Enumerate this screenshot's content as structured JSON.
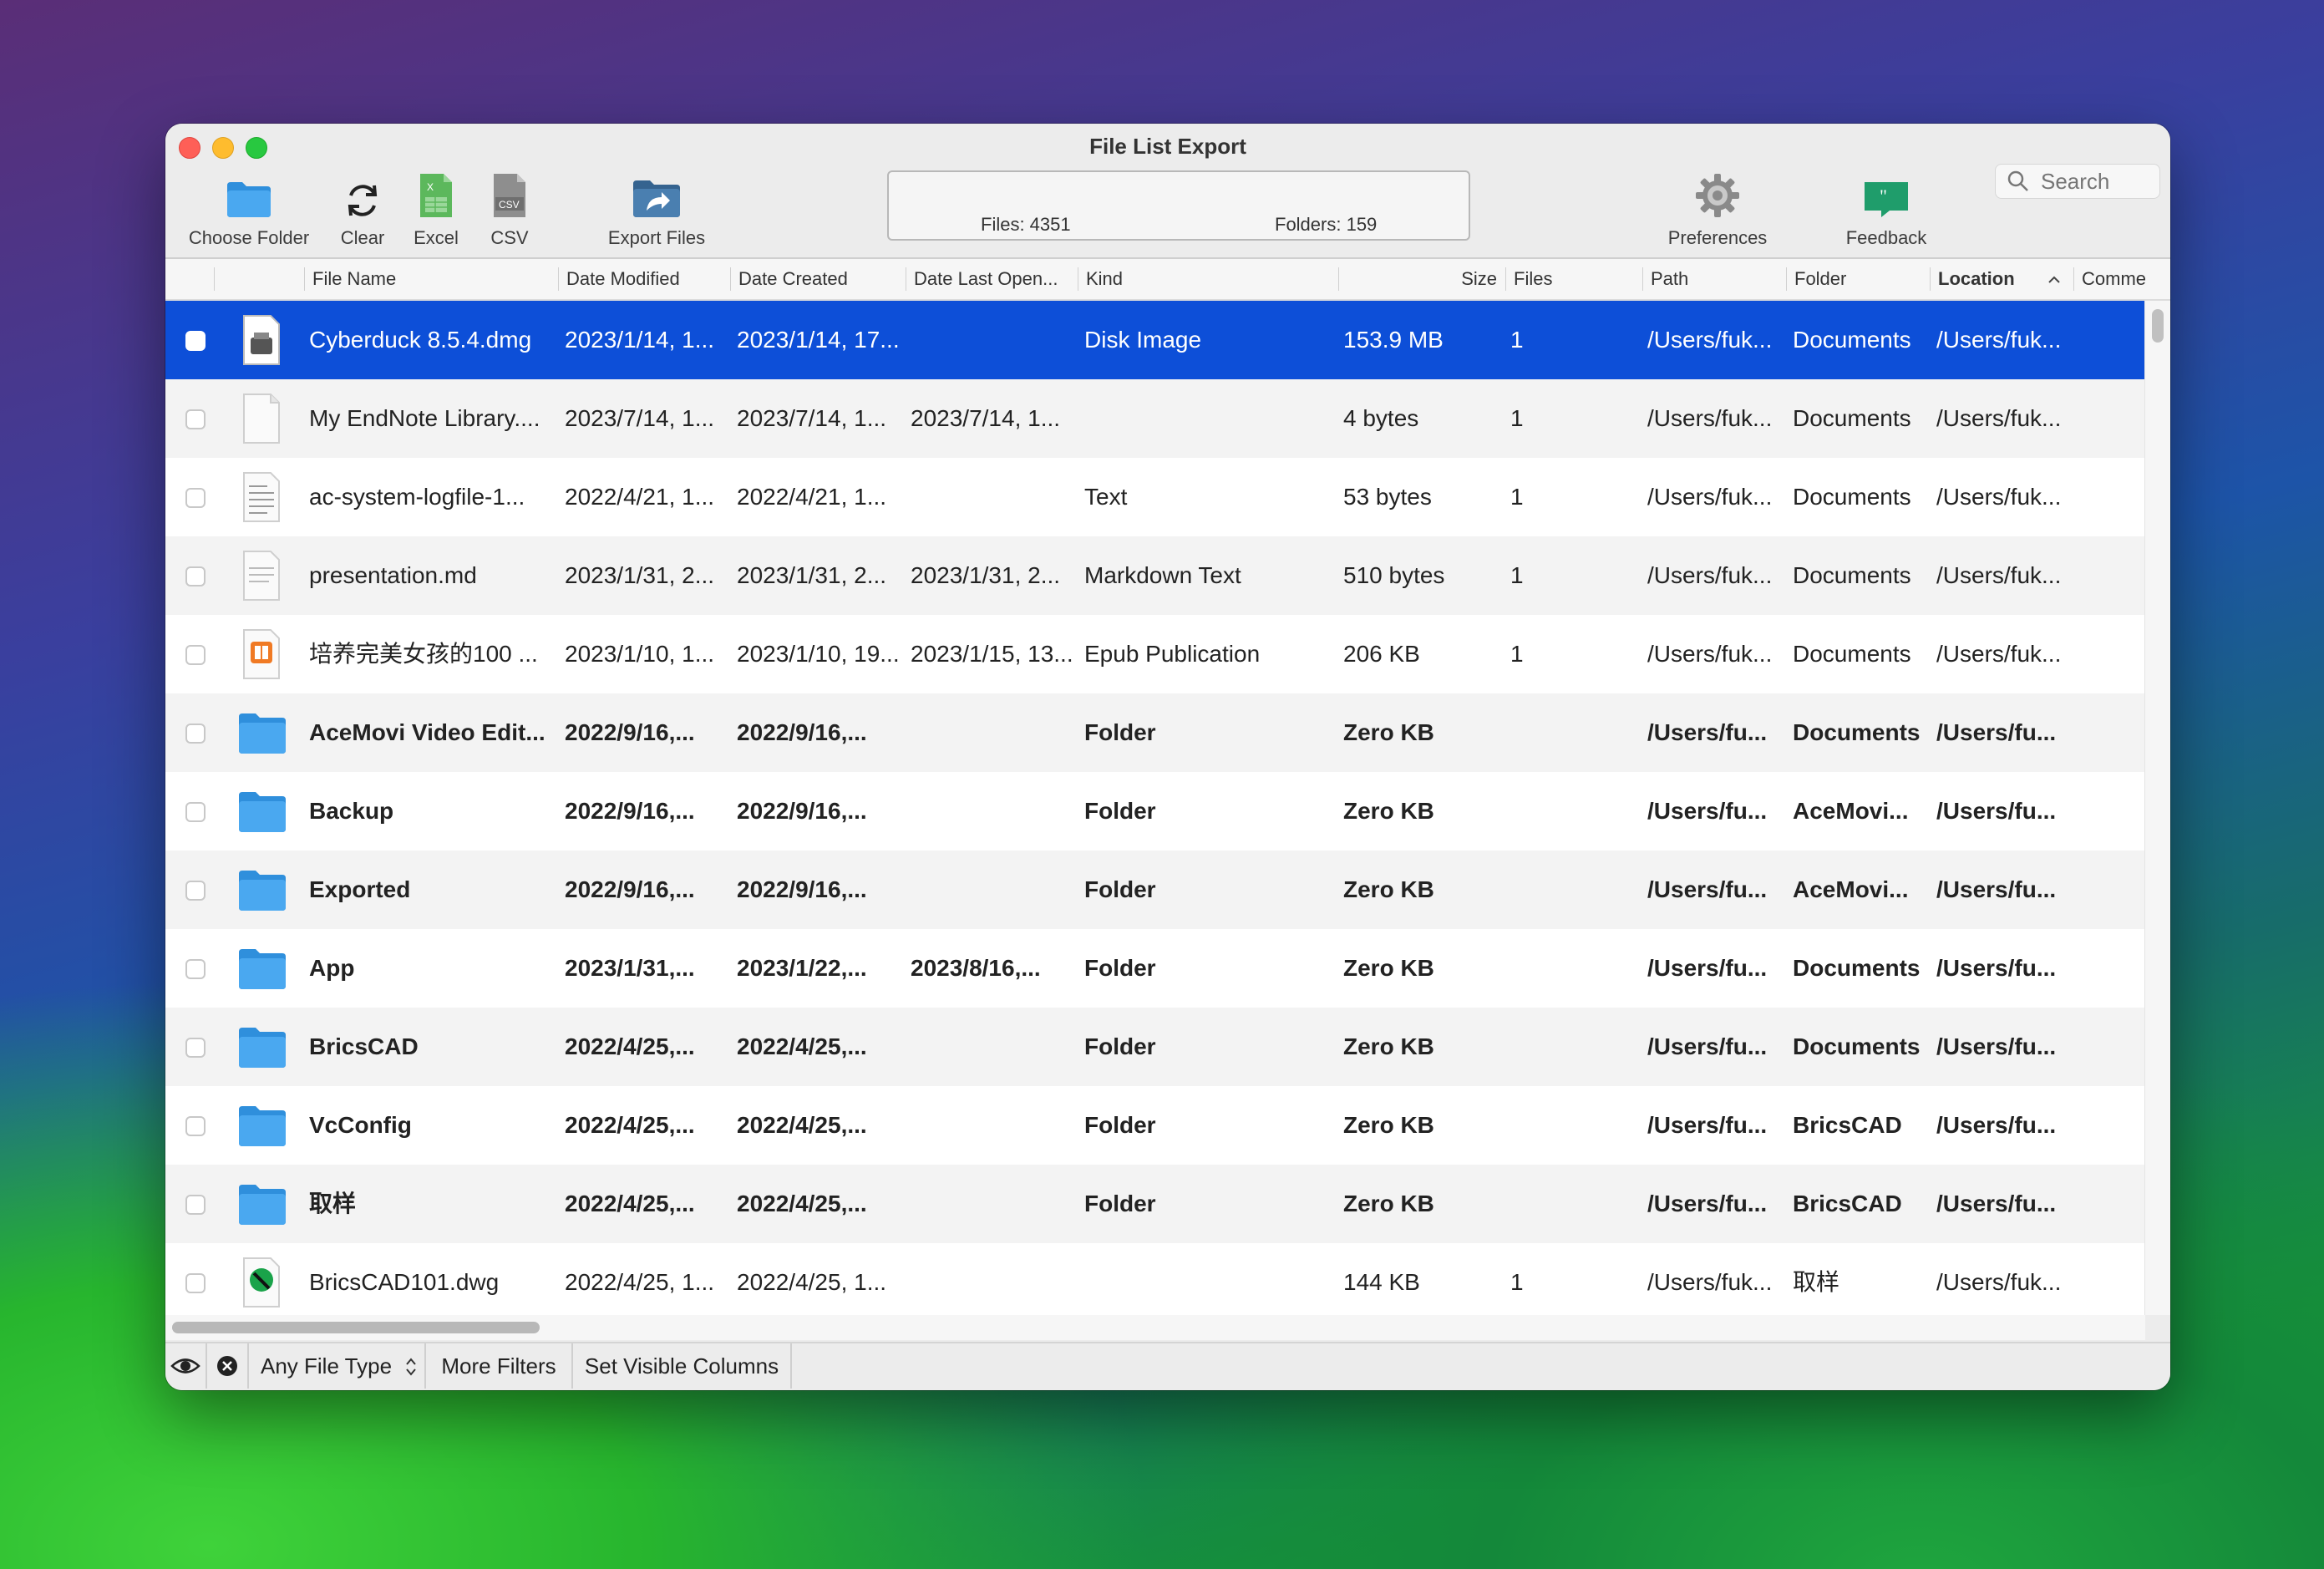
{
  "window": {
    "title": "File List Export"
  },
  "toolbar": {
    "choose_folder": "Choose Folder",
    "clear": "Clear",
    "excel": "Excel",
    "csv": "CSV",
    "export_files": "Export Files",
    "preferences": "Preferences",
    "feedback": "Feedback"
  },
  "stats": {
    "files": "Files: 4351",
    "folders": "Folders: 159"
  },
  "search": {
    "placeholder": "Search"
  },
  "columns": {
    "file_name": "File Name",
    "date_modified": "Date Modified",
    "date_created": "Date Created",
    "date_last_opened": "Date Last Open...",
    "kind": "Kind",
    "size": "Size",
    "files": "Files",
    "path": "Path",
    "folder": "Folder",
    "location": "Location",
    "comments": "Comme"
  },
  "rows": [
    {
      "name": "Cyberduck 8.5.4.dmg",
      "modified": "2023/1/14, 1...",
      "created": "2023/1/14, 17...",
      "opened": "",
      "kind": "Disk Image",
      "size": "153.9 MB",
      "files": "1",
      "path": "/Users/fuk...",
      "folder": "Documents",
      "location": "/Users/fuk...",
      "icon": "disk-image-icon"
    },
    {
      "name": "My EndNote Library....",
      "modified": "2023/7/14, 1...",
      "created": "2023/7/14, 1...",
      "opened": "2023/7/14, 1...",
      "kind": "",
      "size": "4 bytes",
      "files": "1",
      "path": "/Users/fuk...",
      "folder": "Documents",
      "location": "/Users/fuk...",
      "icon": "blank-document-icon"
    },
    {
      "name": "ac-system-logfile-1...",
      "modified": "2022/4/21, 1...",
      "created": "2022/4/21, 1...",
      "opened": "",
      "kind": "Text",
      "size": "53 bytes",
      "files": "1",
      "path": "/Users/fuk...",
      "folder": "Documents",
      "location": "/Users/fuk...",
      "icon": "text-document-icon"
    },
    {
      "name": "presentation.md",
      "modified": "2023/1/31, 2...",
      "created": "2023/1/31, 2...",
      "opened": "2023/1/31, 2...",
      "kind": "Markdown Text",
      "size": "510 bytes",
      "files": "1",
      "path": "/Users/fuk...",
      "folder": "Documents",
      "location": "/Users/fuk...",
      "icon": "markdown-document-icon"
    },
    {
      "name": "培养完美女孩的100 ...",
      "modified": "2023/1/10, 1...",
      "created": "2023/1/10, 19...",
      "opened": "2023/1/15, 13...",
      "kind": "Epub Publication",
      "size": "206 KB",
      "files": "1",
      "path": "/Users/fuk...",
      "folder": "Documents",
      "location": "/Users/fuk...",
      "icon": "epub-icon"
    },
    {
      "name": "AceMovi Video Edit...",
      "modified": "2022/9/16,...",
      "created": "2022/9/16,...",
      "opened": "",
      "kind": "Folder",
      "size": "Zero KB",
      "files": "",
      "path": "/Users/fu...",
      "folder": "Documents",
      "location": "/Users/fu...",
      "icon": "folder-icon"
    },
    {
      "name": "Backup",
      "modified": "2022/9/16,...",
      "created": "2022/9/16,...",
      "opened": "",
      "kind": "Folder",
      "size": "Zero KB",
      "files": "",
      "path": "/Users/fu...",
      "folder": "AceMovi...",
      "location": "/Users/fu...",
      "icon": "folder-icon"
    },
    {
      "name": "Exported",
      "modified": "2022/9/16,...",
      "created": "2022/9/16,...",
      "opened": "",
      "kind": "Folder",
      "size": "Zero KB",
      "files": "",
      "path": "/Users/fu...",
      "folder": "AceMovi...",
      "location": "/Users/fu...",
      "icon": "folder-icon"
    },
    {
      "name": "App",
      "modified": "2023/1/31,...",
      "created": "2023/1/22,...",
      "opened": "2023/8/16,...",
      "kind": "Folder",
      "size": "Zero KB",
      "files": "",
      "path": "/Users/fu...",
      "folder": "Documents",
      "location": "/Users/fu...",
      "icon": "folder-icon"
    },
    {
      "name": "BricsCAD",
      "modified": "2022/4/25,...",
      "created": "2022/4/25,...",
      "opened": "",
      "kind": "Folder",
      "size": "Zero KB",
      "files": "",
      "path": "/Users/fu...",
      "folder": "Documents",
      "location": "/Users/fu...",
      "icon": "folder-icon"
    },
    {
      "name": "VcConfig",
      "modified": "2022/4/25,...",
      "created": "2022/4/25,...",
      "opened": "",
      "kind": "Folder",
      "size": "Zero KB",
      "files": "",
      "path": "/Users/fu...",
      "folder": "BricsCAD",
      "location": "/Users/fu...",
      "icon": "folder-icon"
    },
    {
      "name": "取样",
      "modified": "2022/4/25,...",
      "created": "2022/4/25,...",
      "opened": "",
      "kind": "Folder",
      "size": "Zero KB",
      "files": "",
      "path": "/Users/fu...",
      "folder": "BricsCAD",
      "location": "/Users/fu...",
      "icon": "folder-icon"
    },
    {
      "name": "BricsCAD101.dwg",
      "modified": "2022/4/25, 1...",
      "created": "2022/4/25, 1...",
      "opened": "",
      "kind": "",
      "size": "144 KB",
      "files": "1",
      "path": "/Users/fuk...",
      "folder": "取样",
      "location": "/Users/fuk...",
      "icon": "dwg-icon"
    }
  ],
  "bottombar": {
    "file_type": "Any File Type",
    "more_filters": "More Filters",
    "set_visible_columns": "Set Visible Columns"
  },
  "colors": {
    "selection": "#0d4fd8",
    "folder": "#3d9fe8"
  }
}
